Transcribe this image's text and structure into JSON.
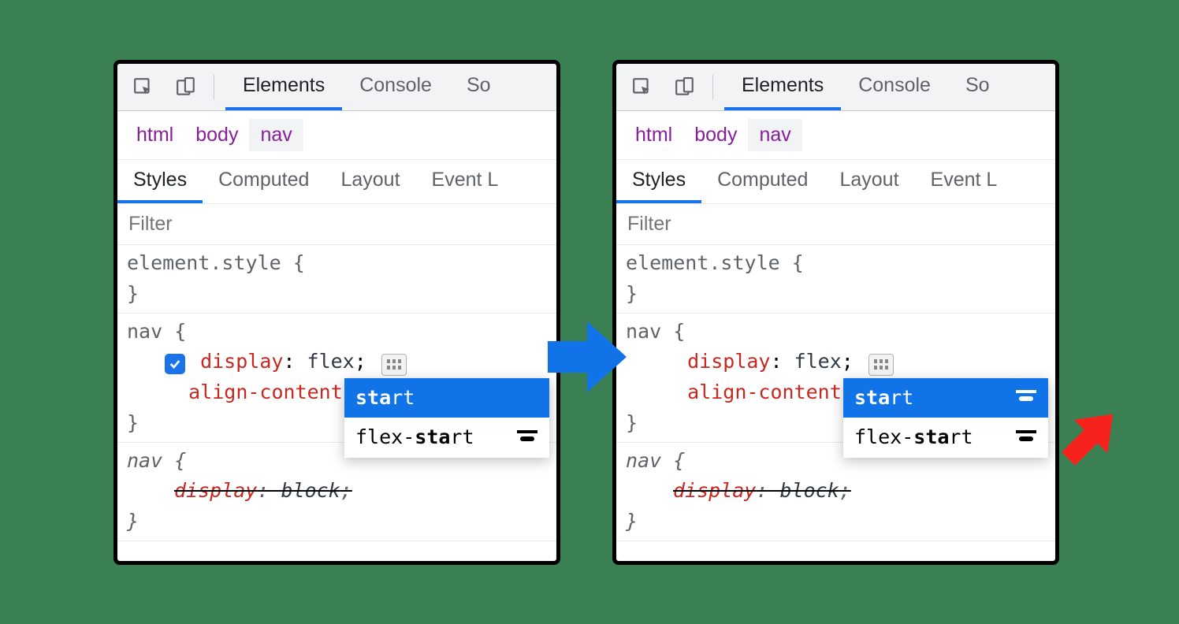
{
  "top_tabs": {
    "elements": "Elements",
    "console": "Console",
    "sources_truncated": "So"
  },
  "breadcrumb": {
    "html": "html",
    "body": "body",
    "nav": "nav"
  },
  "sub_tabs": {
    "styles": "Styles",
    "computed": "Computed",
    "layout": "Layout",
    "event_truncated": "Event L"
  },
  "filter": {
    "placeholder": "Filter"
  },
  "element_style": {
    "selector": "element.style {",
    "close": "}"
  },
  "nav_rule": {
    "selector": "nav {",
    "display_prop": "display",
    "display_val": "flex",
    "align_prop": "align-content",
    "align_val_prefix": "sta",
    "align_val_rest": "rt",
    "semicolon": ";",
    "colon": ": ",
    "close": "}"
  },
  "overridden_rule": {
    "selector": "nav {",
    "display_prop": "display",
    "display_val": "block",
    "colon": ": ",
    "semicolon": ";",
    "close": "}"
  },
  "autocomplete": {
    "item1_bold": "sta",
    "item1_rest": "rt",
    "item2_pre": "flex-",
    "item2_bold": "sta",
    "item2_rest": "rt"
  }
}
